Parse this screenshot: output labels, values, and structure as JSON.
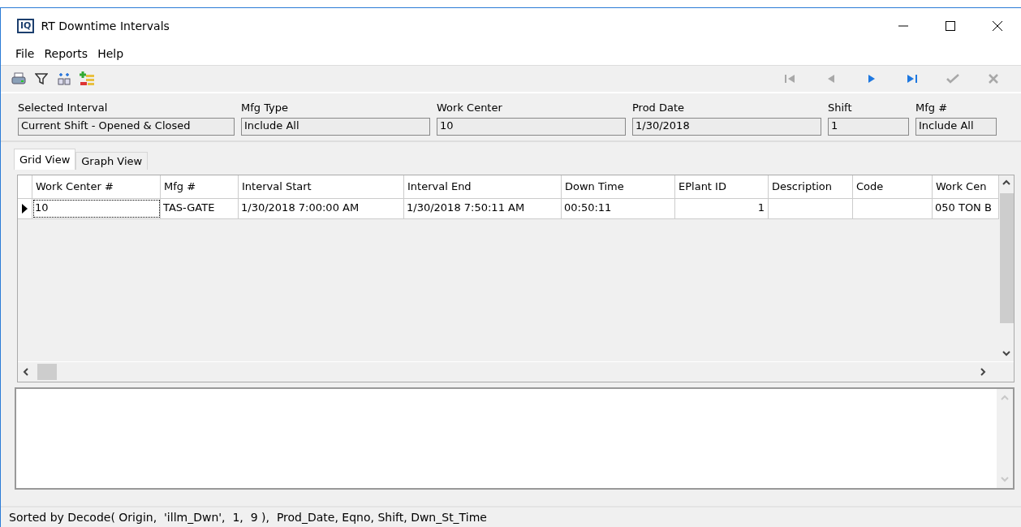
{
  "window": {
    "title": "RT Downtime Intervals",
    "logo": "IQ"
  },
  "menu": [
    "File",
    "Reports",
    "Help"
  ],
  "toolbar": {
    "tools": [
      {
        "kind": "print"
      },
      {
        "kind": "filter"
      },
      {
        "kind": "columns"
      },
      {
        "kind": "add-list"
      }
    ],
    "nav": [
      {
        "kind": "first",
        "disabled": true
      },
      {
        "kind": "prev",
        "disabled": true
      },
      {
        "kind": "next",
        "disabled": false
      },
      {
        "kind": "last",
        "disabled": false
      },
      {
        "kind": "post",
        "disabled": true
      },
      {
        "kind": "cancel",
        "disabled": true
      }
    ]
  },
  "filters": [
    {
      "label": "Selected Interval",
      "value": "Current Shift - Opened & Closed"
    },
    {
      "label": "Mfg Type",
      "value": "Include All"
    },
    {
      "label": "Work Center",
      "value": "10"
    },
    {
      "label": "Prod Date",
      "value": "1/30/2018"
    },
    {
      "label": "Shift",
      "value": "1"
    },
    {
      "label": "Mfg #",
      "value": "Include All"
    }
  ],
  "tabs": [
    {
      "label": "Grid View",
      "selected": true
    },
    {
      "label": "Graph View",
      "selected": false
    }
  ],
  "table": {
    "columns": [
      {
        "label": "Work Center #",
        "kind": "text"
      },
      {
        "label": "Mfg #",
        "kind": "text"
      },
      {
        "label": "Interval Start",
        "kind": "text"
      },
      {
        "label": "Interval End",
        "kind": "text"
      },
      {
        "label": "Down Time",
        "kind": "text"
      },
      {
        "label": "EPlant ID",
        "kind": "number"
      },
      {
        "label": "Description",
        "kind": "text"
      },
      {
        "label": "Code",
        "kind": "text"
      },
      {
        "label": "Work Cen",
        "kind": "text"
      }
    ],
    "rows": [
      {
        "selected": true,
        "cells": [
          "10",
          "TAS-GATE",
          "1/30/2018 7:00:00 AM",
          "1/30/2018 7:50:11 AM",
          "00:50:11",
          "1",
          "",
          "",
          "050 TON B"
        ]
      }
    ]
  },
  "status_bar": "Sorted by Decode( Origin,  'illm_Dwn',  1,  9 ),  Prod_Date, Eqno, Shift, Dwn_St_Time"
}
